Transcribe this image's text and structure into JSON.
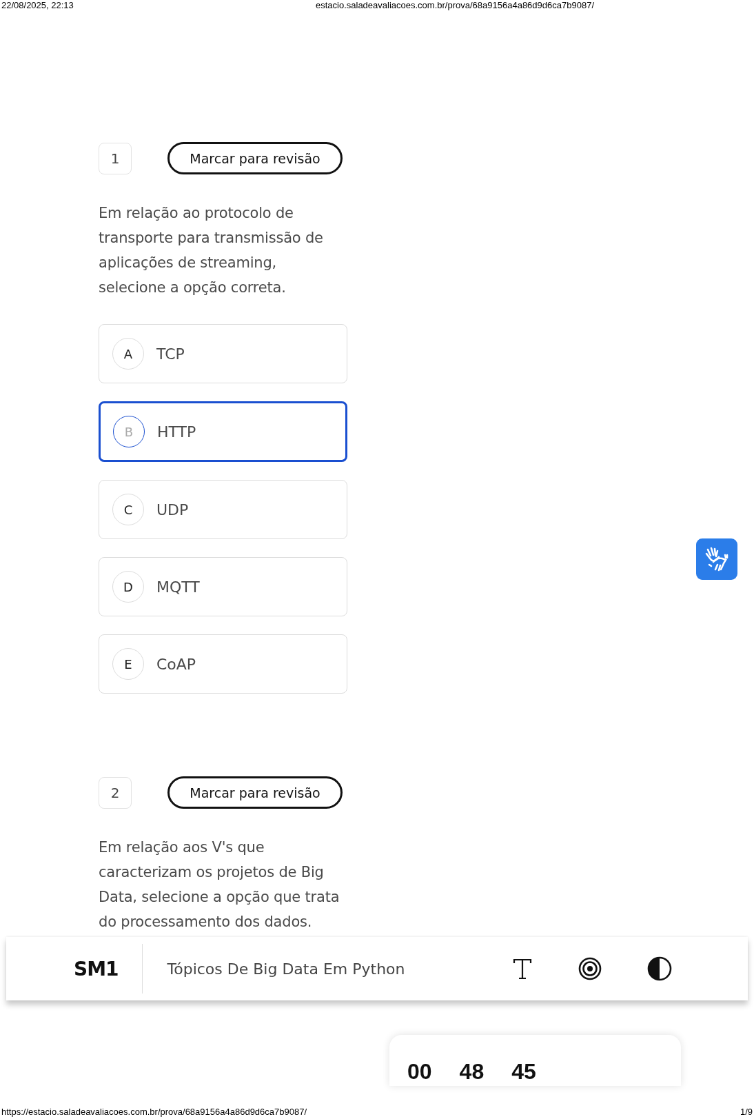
{
  "browser_header": {
    "date": "22/08/2025, 22:13",
    "url": "estacio.saladeavaliacoes.com.br/prova/68a9156a4a86d9d6ca7b9087/"
  },
  "questions": [
    {
      "number": "1",
      "review_button": "Marcar para revisão",
      "text": "Em relação ao protocolo de transporte para transmissão de aplicações de streaming, selecione a opção correta.",
      "options": [
        {
          "letter": "A",
          "label": "TCP",
          "selected": false
        },
        {
          "letter": "B",
          "label": "HTTP",
          "selected": true
        },
        {
          "letter": "C",
          "label": "UDP",
          "selected": false
        },
        {
          "letter": "D",
          "label": "MQTT",
          "selected": false
        },
        {
          "letter": "E",
          "label": "CoAP",
          "selected": false
        }
      ]
    },
    {
      "number": "2",
      "review_button": "Marcar para revisão",
      "text": "Em relação aos V's que caracterizam os projetos de Big Data, selecione a opção que trata do processamento dos dados."
    }
  ],
  "bottom_bar": {
    "logo": "SM1",
    "course": "Tópicos De Big Data Em Python"
  },
  "timer": {
    "hours": "00",
    "minutes": "48",
    "seconds": "45"
  },
  "footer": {
    "url": "https://estacio.saladeavaliacoes.com.br/prova/68a9156a4a86d9d6ca7b9087/",
    "page": "1/9"
  }
}
